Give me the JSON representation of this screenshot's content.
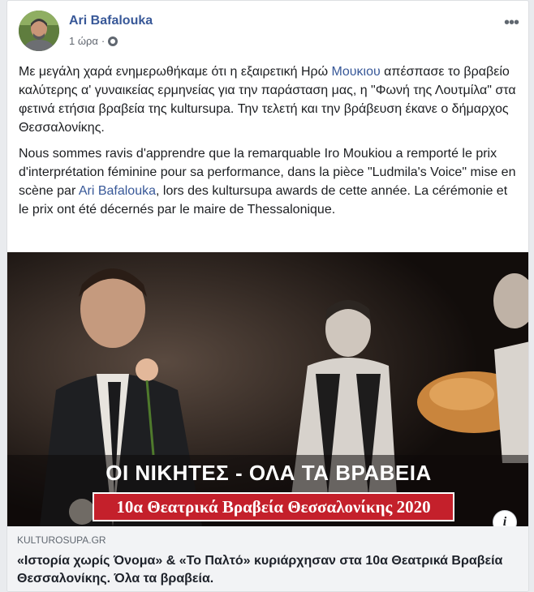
{
  "post": {
    "author": "Ari Bafalouka",
    "time": "1 ώρα",
    "privacy_icon": "globe-icon",
    "more_icon": "ellipsis-icon",
    "more_glyph": "•••"
  },
  "body": {
    "p1_a": "Με μεγάλη χαρά ενημερωθήκαμε ότι η εξαιρετική Ηρώ ",
    "p1_link": "Μουκιου",
    "p1_b": " απέσπασε το βραβείο καλύτερης α' γυναικείας ερμηνείας για την παράσταση μας, η \"Φωνή της Λουτμίλα\" στα φετινά ετήσια βραβεία της kultursupa. Την τελετή και την βράβευση έκανε ο δήμαρχος Θεσσαλονίκης.",
    "p2_a": "Nous sommes ravis d'apprendre que la remarquable Iro Moukiou a remporté le prix d'interprétation féminine pour sa performance, dans la pièce \"Ludmila's Voice\" mise en scène par ",
    "p2_link": "Ari Bafalouka",
    "p2_b": ", lors des kultursupa awards de cette année. La cérémonie et le prix ont été décernés par le maire de Thessalonique."
  },
  "image": {
    "caption": "ΟΙ ΝΙΚΗΤΕΣ - ΟΛΑ ΤΑ ΒΡΑΒΕΙΑ",
    "banner": "10α Θεατρικά Βραβεία Θεσσαλονίκης 2020",
    "banner_color": "#c4202b",
    "info_glyph": "i"
  },
  "link_preview": {
    "domain": "KULTUROSUPA.GR",
    "headline": "«Ιστορία χωρίς Όνομα» & «Το Παλτό» κυριάρχησαν στα 10α Θεατρικά Βραβεία Θεσσαλονίκης. Όλα τα βραβεία."
  },
  "colors": {
    "link": "#385898",
    "background": "#e9ebee"
  }
}
